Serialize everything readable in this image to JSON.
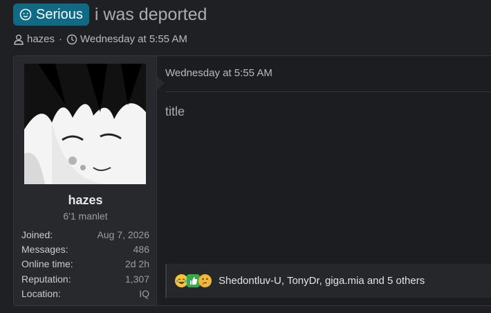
{
  "thread": {
    "prefix": "Serious",
    "title": "i was deported",
    "author": "hazes",
    "separator": "·",
    "date": "Wednesday at 5:55 AM"
  },
  "post": {
    "date": "Wednesday at 5:55 AM",
    "body": "title",
    "user": {
      "name": "hazes",
      "title": "6'1 manlet",
      "stats": [
        {
          "label": "Joined:",
          "value": "Aug 7, 2026"
        },
        {
          "label": "Messages:",
          "value": "486"
        },
        {
          "label": "Online time:",
          "value": "2d 2h"
        },
        {
          "label": "Reputation:",
          "value": "1,307"
        },
        {
          "label": "Location:",
          "value": "IQ"
        }
      ]
    },
    "reactions": {
      "icons": [
        "laugh-emoji",
        "thumbs-up-emoji",
        "thinking-emoji"
      ],
      "text": "Shedontluv-U, TonyDr, giga.mia and 5 others"
    }
  },
  "colors": {
    "prefix_bg": "#0f6a86",
    "page_bg": "#1f2023",
    "panel_bg": "#27292d"
  }
}
